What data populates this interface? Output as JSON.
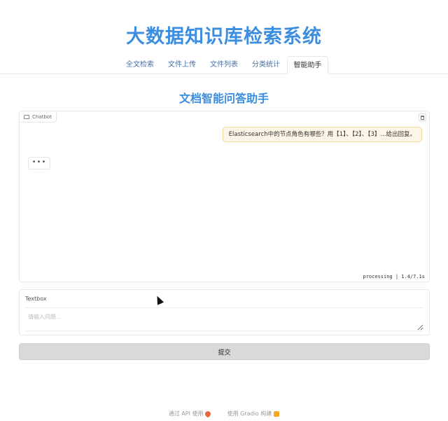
{
  "app": {
    "title": "大数据知识库检索系统"
  },
  "tabs": [
    {
      "label": "全文检索",
      "active": false
    },
    {
      "label": "文件上传",
      "active": false
    },
    {
      "label": "文件列表",
      "active": false
    },
    {
      "label": "分类统计",
      "active": false
    },
    {
      "label": "智能助手",
      "active": true
    }
  ],
  "assistant": {
    "section_title": "文档智能问答助手",
    "chatbot": {
      "label": "Chatbot",
      "messages": [
        {
          "role": "user",
          "text": "Elasticsearch中的节点角色有哪些？用【1】、【2】、【3】...给出回复。"
        },
        {
          "role": "assistant",
          "text": "•••"
        }
      ],
      "status": "processing | 1.4/7.1s"
    },
    "textbox": {
      "label": "Textbox",
      "value": "",
      "placeholder": "请输入问题..."
    },
    "submit_label": "提交"
  },
  "footer": {
    "api_text": "通过 API 使用",
    "built_text": "使用 Gradio 构建"
  },
  "colors": {
    "accent": "#3b8de0",
    "user_bubble_bg": "#fdf6e6",
    "user_bubble_border": "#f3d89b",
    "submit_bg": "#d9d9d9"
  }
}
